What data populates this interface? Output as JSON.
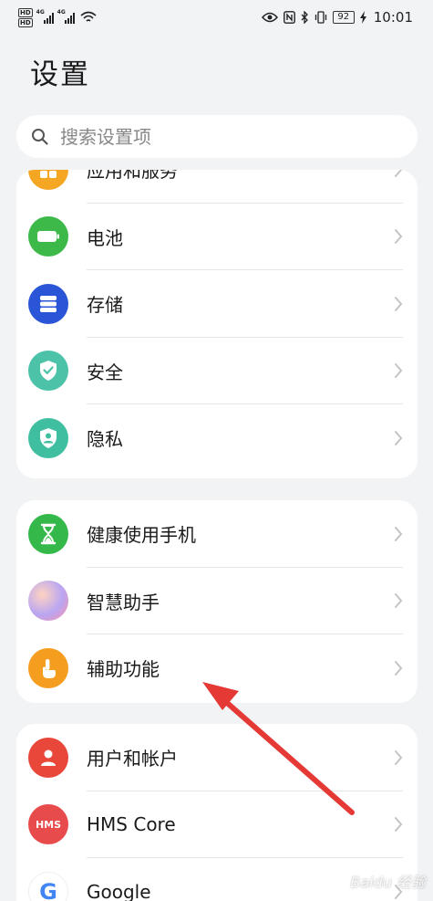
{
  "status_bar": {
    "hd1": "HD",
    "hd2": "HD",
    "net1": "4G",
    "net2": "4G",
    "battery": "92",
    "time": "10:01"
  },
  "page": {
    "title": "设置"
  },
  "search": {
    "placeholder": "搜索设置项"
  },
  "groups": [
    {
      "items": [
        {
          "label": "应用和服务",
          "icon": "apps-icon",
          "color": "#f5a623"
        },
        {
          "label": "电池",
          "icon": "battery-icon",
          "color": "#3db94a"
        },
        {
          "label": "存储",
          "icon": "storage-icon",
          "color": "#2a55d6"
        },
        {
          "label": "安全",
          "icon": "shield-check-icon",
          "color": "#4cc3a8"
        },
        {
          "label": "隐私",
          "icon": "privacy-shield-icon",
          "color": "#3fbfa0"
        }
      ]
    },
    {
      "items": [
        {
          "label": "健康使用手机",
          "icon": "hourglass-icon",
          "color": "#34b84a"
        },
        {
          "label": "智慧助手",
          "icon": "assistant-orb-icon",
          "color": "#b9a6f2"
        },
        {
          "label": "辅助功能",
          "icon": "hand-pointer-icon",
          "color": "#f59d1e"
        }
      ]
    },
    {
      "items": [
        {
          "label": "用户和帐户",
          "icon": "user-icon",
          "color": "#e8473a"
        },
        {
          "label": "HMS Core",
          "icon": "hms-icon",
          "color": "#e84b4b",
          "icon_text": "HMS"
        },
        {
          "label": "Google",
          "icon": "google-icon",
          "color": "#4285f4",
          "icon_text": "G"
        }
      ]
    }
  ],
  "annotation": {
    "arrow_color": "#e53935"
  },
  "watermark": {
    "text": "Baidu 经验"
  }
}
